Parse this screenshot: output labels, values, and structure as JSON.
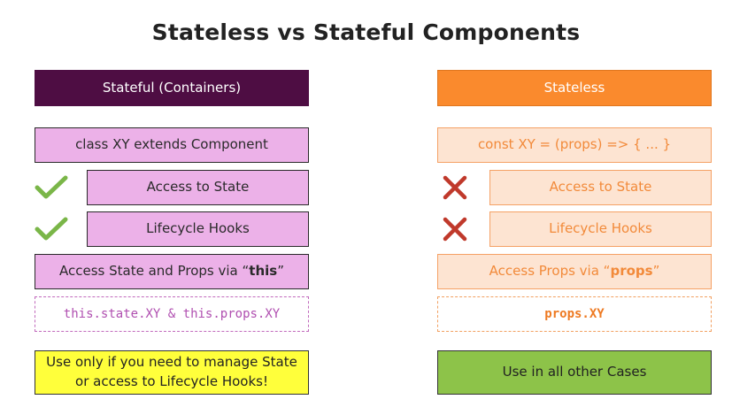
{
  "title": "Stateless vs Stateful Components",
  "stateful": {
    "header": "Stateful (Containers)",
    "definition": "class XY extends Component",
    "feature_1": "Access to State",
    "feature_2": "Lifecycle Hooks",
    "access_prefix": "Access State and Props via “",
    "access_keyword": "this",
    "access_suffix": "”",
    "code": "this.state.XY & this.props.XY",
    "usage": "Use only if you need to manage State or access to Lifecycle Hooks!",
    "feature_icon": "check-icon"
  },
  "stateless": {
    "header": "Stateless",
    "definition": "const XY = (props) => { ... }",
    "feature_1": "Access to State",
    "feature_2": "Lifecycle Hooks",
    "access_prefix": "Access Props via “",
    "access_keyword": "props",
    "access_suffix": "”",
    "code": "props.XY",
    "usage": "Use in all other Cases",
    "feature_icon": "cross-icon"
  },
  "colors": {
    "stateful_header": "#4e0d43",
    "stateful_fill": "#ecb1e8",
    "stateless_header": "#fa8a2d",
    "stateless_fill": "#fde4d2",
    "check": "#7ab648",
    "cross": "#c0392b",
    "yellow": "#ffff3b",
    "green": "#8dc349"
  }
}
